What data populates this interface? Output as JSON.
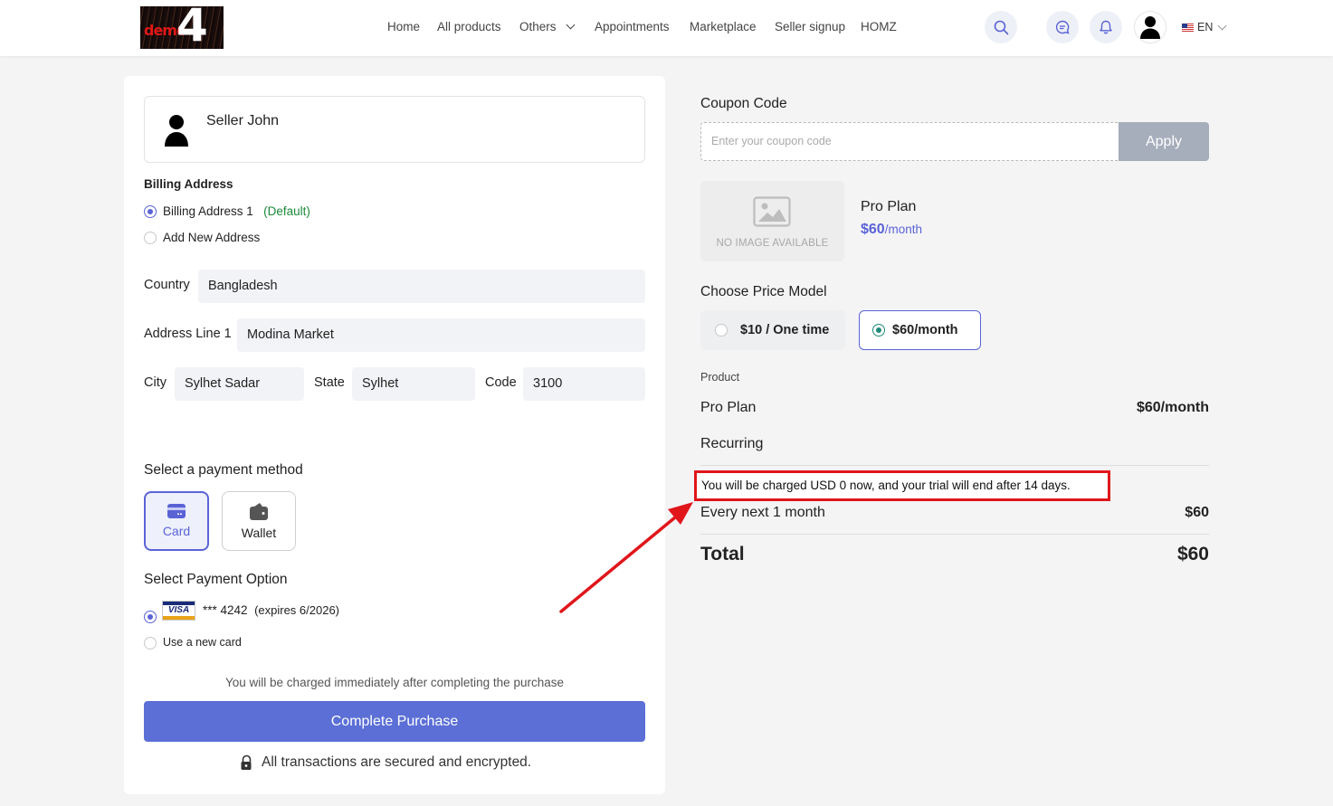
{
  "header": {
    "logo_small": "demo",
    "logo_big": "4",
    "nav": [
      {
        "label": "Home"
      },
      {
        "label": "All products"
      },
      {
        "label": "Others"
      },
      {
        "label": "Appointments"
      },
      {
        "label": "Marketplace"
      },
      {
        "label": "Seller signup"
      },
      {
        "label": "HOMZ"
      }
    ],
    "language": "EN",
    "icons": [
      "search-icon",
      "chat-icon",
      "bell-icon",
      "user-icon",
      "us-flag-icon"
    ]
  },
  "seller": {
    "name": "Seller John"
  },
  "billing": {
    "title": "Billing Address",
    "options": [
      {
        "label": "Billing Address 1",
        "tag": "(Default)",
        "selected": true
      },
      {
        "label": "Add New Address",
        "selected": false
      }
    ],
    "country_label": "Country",
    "country_value": "Bangladesh",
    "address_label": "Address Line 1",
    "address_value": "Modina Market",
    "city_label": "City",
    "city_value": "Sylhet Sadar",
    "state_label": "State",
    "state_value": "Sylhet",
    "code_label": "Code",
    "code_value": "3100"
  },
  "payment_method": {
    "title": "Select a payment method",
    "methods": [
      {
        "label": "Card",
        "selected": true,
        "icon": "card-icon"
      },
      {
        "label": "Wallet",
        "selected": false,
        "icon": "wallet-icon"
      }
    ]
  },
  "payment_option": {
    "title": "Select Payment Option",
    "saved_card": "*** 4242",
    "saved_card_expiry": "(expires 6/2026)",
    "card_brand": "VISA",
    "new_card_label": "Use a new card"
  },
  "purchase": {
    "note": "You will be charged immediately after completing the purchase",
    "button_label": "Complete Purchase",
    "secure_text": "All transactions are secured and encrypted.",
    "accent": "#5b6fd6"
  },
  "coupon": {
    "title": "Coupon Code",
    "placeholder": "Enter your coupon code",
    "apply_label": "Apply"
  },
  "plan": {
    "no_image_text": "NO IMAGE AVAILABLE",
    "name": "Pro Plan",
    "price": "$60",
    "period": "/month"
  },
  "price_model": {
    "title": "Choose Price Model",
    "options": [
      {
        "label": "$10 / One time",
        "selected": false
      },
      {
        "label": "$60/month",
        "selected": true
      }
    ]
  },
  "summary": {
    "product_header": "Product",
    "product_name": "Pro Plan",
    "product_price": "$60/month",
    "recurring_label": "Recurring",
    "trial_notice": "You will be charged USD 0 now, and your trial will end after 14 days.",
    "every_label": "Every next 1 month",
    "every_value": "$60",
    "total_label": "Total",
    "total_value": "$60",
    "highlight_color": "#e0161b"
  }
}
